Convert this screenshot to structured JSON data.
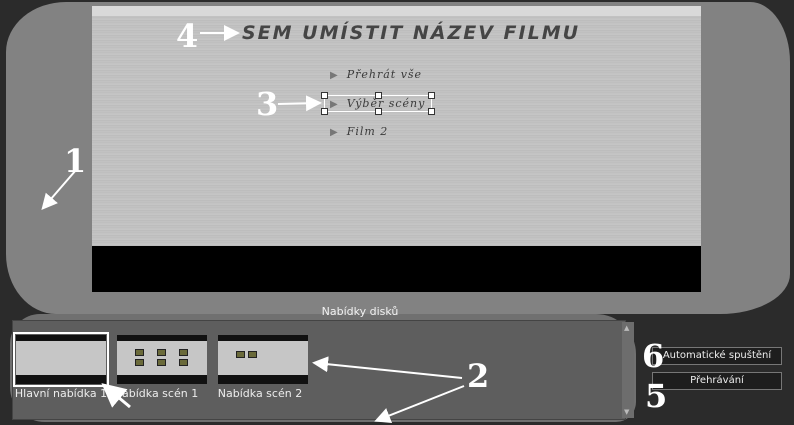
{
  "preview": {
    "movie_title": "SEM UMÍSTIT NÁZEV FILMU",
    "menu_items": [
      "Přehrát vše",
      "Výběr scény",
      "Film 2"
    ]
  },
  "disc_menus": {
    "label": "Nabídky disků",
    "thumbnails": [
      {
        "label": "Hlavní nabídka 1",
        "selected": true
      },
      {
        "label": "Nabídka scén 1",
        "selected": false
      },
      {
        "label": "Nabídka scén 2",
        "selected": false
      }
    ]
  },
  "buttons": {
    "autoplay": "Automatické spuštění",
    "playback": "Přehrávání"
  },
  "callouts": [
    "1",
    "2",
    "3",
    "4",
    "5",
    "6"
  ],
  "colors": {
    "background": "#2b2b2b",
    "highlight": "#8a8a8a",
    "callout": "#ffffff"
  }
}
